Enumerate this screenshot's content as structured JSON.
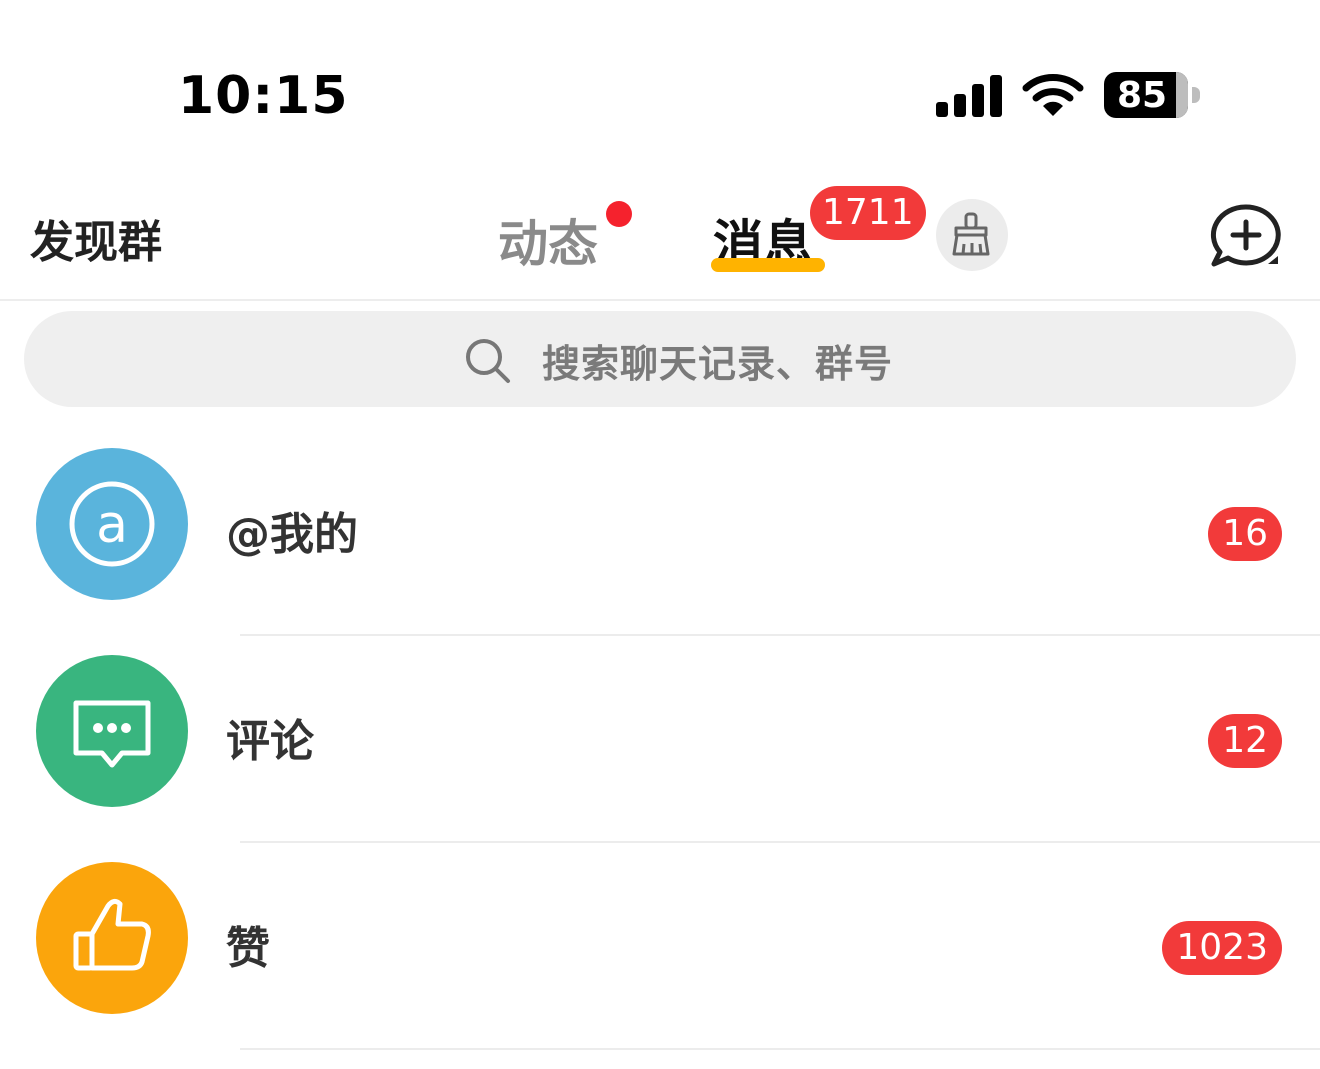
{
  "status_bar": {
    "time": "10:15",
    "battery_level": "85"
  },
  "header": {
    "left_label": "发现群",
    "tabs": [
      {
        "label": "动态",
        "has_dot": true
      },
      {
        "label": "消息",
        "badge": "1711",
        "active": true
      }
    ],
    "icons": {
      "clean": "broom-icon",
      "new_chat": "add-chat-icon"
    }
  },
  "search": {
    "placeholder": "搜索聊天记录、群号"
  },
  "list": {
    "items": [
      {
        "label": "@我的",
        "badge": "16",
        "icon": "at-icon",
        "color": "#5ab4dc"
      },
      {
        "label": "评论",
        "badge": "12",
        "icon": "comment-icon",
        "color": "#39b57f"
      },
      {
        "label": "赞",
        "badge": "1023",
        "icon": "thumbs-up-icon",
        "color": "#fba50c"
      }
    ]
  },
  "colors": {
    "accent": "#ffb300",
    "badge": "#f23a3a"
  }
}
